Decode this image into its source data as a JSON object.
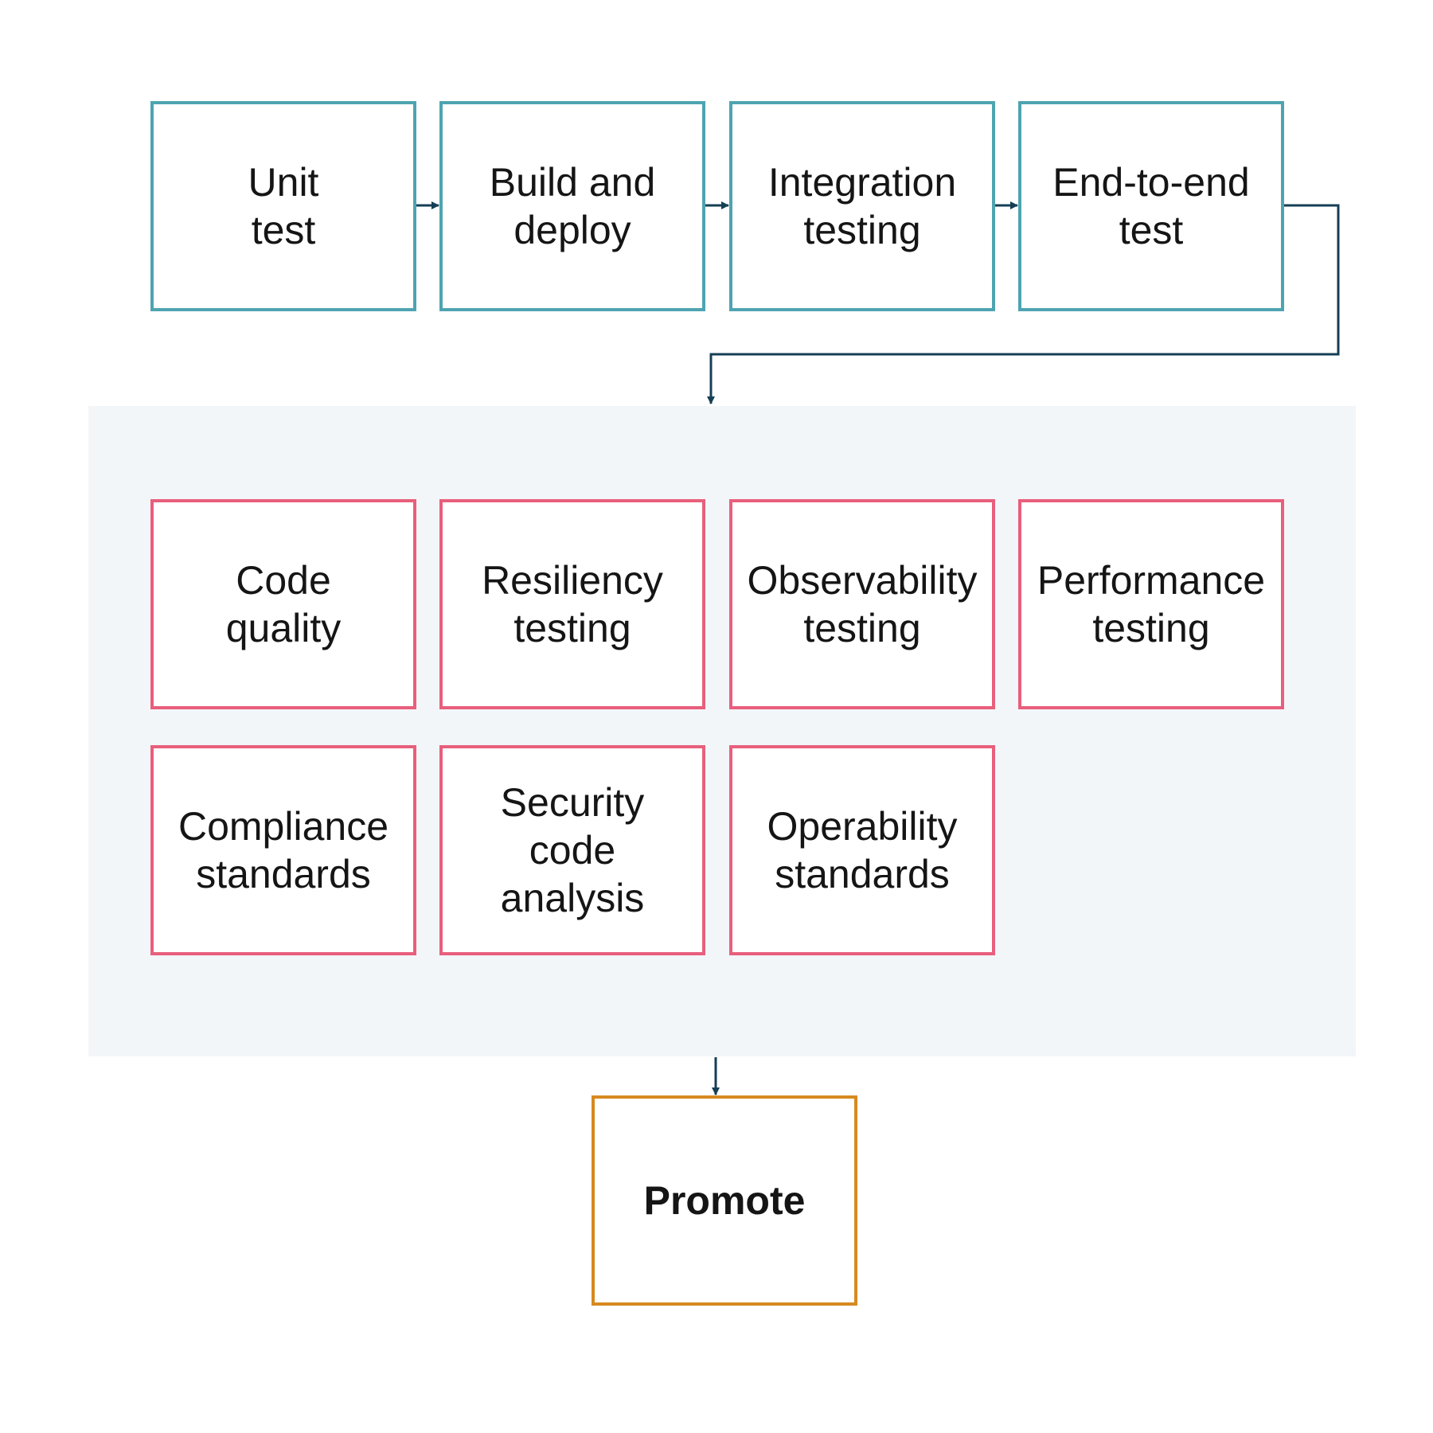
{
  "diagram": {
    "pipeline_stages": [
      {
        "label": "Unit\ntest"
      },
      {
        "label": "Build and\ndeploy"
      },
      {
        "label": "Integration\ntesting"
      },
      {
        "label": "End-to-end\ntest"
      }
    ],
    "quality_gates": [
      {
        "label": "Code\nquality"
      },
      {
        "label": "Resiliency\ntesting"
      },
      {
        "label": "Observability\ntesting"
      },
      {
        "label": "Performance\ntesting"
      },
      {
        "label": "Compliance\nstandards"
      },
      {
        "label": "Security\ncode\nanalysis"
      },
      {
        "label": "Operability\nstandards"
      }
    ],
    "final_stage": {
      "label": "Promote"
    },
    "colors": {
      "pipeline_border": "#4ea4b1",
      "gate_border": "#e85f7c",
      "final_border": "#d68a1f",
      "connector": "#153f55",
      "panel_background": "#f2f6f9"
    }
  }
}
